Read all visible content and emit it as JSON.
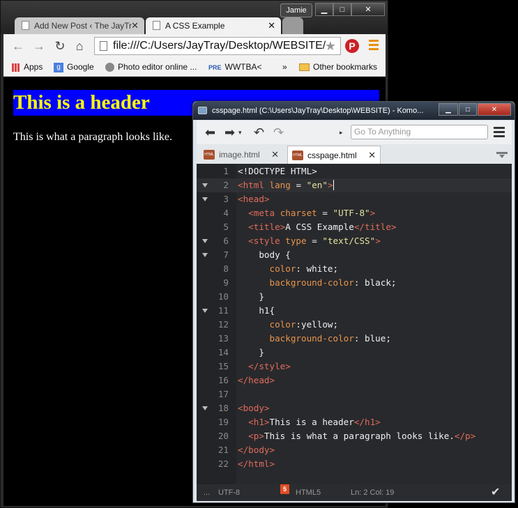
{
  "chrome": {
    "user": "Jamie",
    "tabs": [
      {
        "label": "Add New Post ‹ The JayTr"
      },
      {
        "label": "A CSS Example"
      }
    ],
    "url": "file:///C:/Users/JayTray/Desktop/WEBSITE/",
    "bookmarks": [
      {
        "label": "Apps"
      },
      {
        "label": "Google"
      },
      {
        "label": "Photo editor online ..."
      },
      {
        "label": "WWTBA<"
      }
    ],
    "overflow": "»",
    "other_bookmarks": "Other bookmarks",
    "page": {
      "header": "This is a header",
      "paragraph": "This is what a paragraph looks like."
    }
  },
  "komodo": {
    "title": "csspage.html (C:\\Users\\JayTray\\Desktop\\WEBSITE) - Komo...",
    "goto_placeholder": "Go To Anything",
    "tabs": [
      {
        "label": "image.html"
      },
      {
        "label": "csspage.html"
      }
    ],
    "status": {
      "dots": "...",
      "encoding": "UTF-8",
      "language": "HTML5",
      "position": "Ln: 2 Col: 19"
    },
    "line_numbers": [
      "1",
      "2",
      "3",
      "4",
      "5",
      "6",
      "7",
      "8",
      "9",
      "10",
      "11",
      "12",
      "13",
      "14",
      "15",
      "16",
      "17",
      "18",
      "19",
      "20",
      "21",
      "22"
    ]
  },
  "colors": {
    "header_bg": "#0000ff",
    "header_text": "#ffff00",
    "editor_bg": "#28292c",
    "tag": "#e06c5c",
    "attribute": "#e7954d"
  }
}
